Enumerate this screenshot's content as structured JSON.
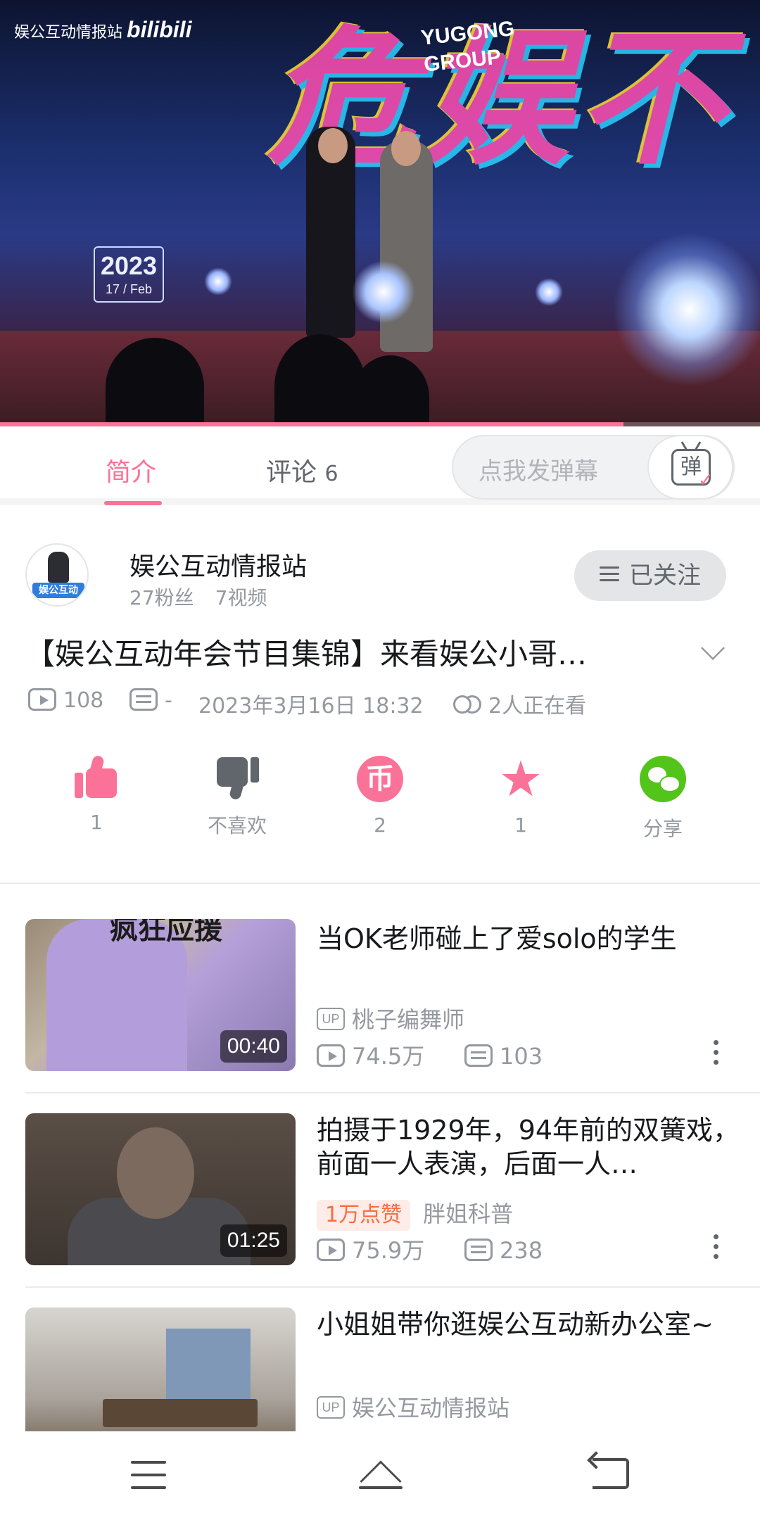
{
  "player": {
    "watermark_channel": "娱公互动情报站",
    "watermark_brand": "bilibili",
    "stage_text": "YUGONG GROUP",
    "stage_date_year": "2023",
    "stage_date_day": "17 / Feb",
    "progress_fraction": 0.82
  },
  "tabs": {
    "intro_label": "简介",
    "comments_label": "评论",
    "comments_count": "6",
    "danmaku_placeholder": "点我发弹幕",
    "danmaku_button_glyph": "弹"
  },
  "uploader": {
    "name": "娱公互动情报站",
    "fans": "27粉丝",
    "videos": "7视频",
    "avatar_tag": "娱公互动",
    "follow_label": "已关注"
  },
  "video": {
    "title": "【娱公互动年会节目集锦】来看娱公小哥…",
    "views": "108",
    "danmaku_count": "-",
    "publish_time": "2023年3月16日 18:32",
    "watching_now": "2人正在看"
  },
  "actions": {
    "like_count": "1",
    "dislike_label": "不喜欢",
    "coin_count": "2",
    "coin_glyph": "币",
    "favorite_count": "1",
    "share_label": "分享"
  },
  "related": [
    {
      "title": "当OK老师碰上了爱solo的学生",
      "thumb_caption": "疯狂应援",
      "duration": "00:40",
      "up_badge": "UP",
      "uploader": "桃子编舞师",
      "views": "74.5万",
      "comments": "103"
    },
    {
      "title": "拍摄于1929年，94年前的双簧戏，前面一人表演，后面一人…",
      "duration": "01:25",
      "like_badge": "1万点赞",
      "uploader": "胖姐科普",
      "views": "75.9万",
      "comments": "238"
    },
    {
      "title": "小姐姐带你逛娱公互动新办公室~",
      "up_badge": "UP",
      "uploader": "娱公互动情报站"
    }
  ],
  "colors": {
    "accent": "#fb7299",
    "share_green": "#52c41a",
    "text_secondary": "#9499a0"
  }
}
